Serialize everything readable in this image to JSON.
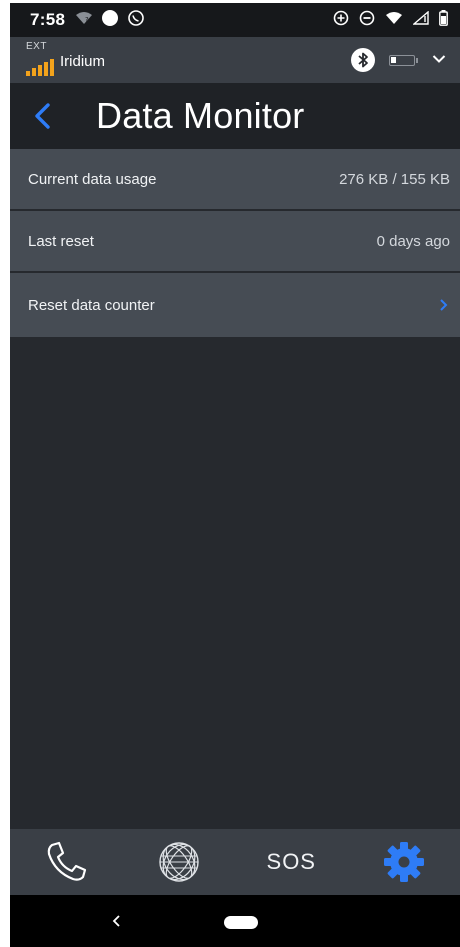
{
  "status_bar": {
    "time": "7:58"
  },
  "carrier": {
    "ext_label": "EXT",
    "name": "Iridium",
    "signal_color": "#f3a31c"
  },
  "header": {
    "title": "Data Monitor",
    "accent_color": "#2e7cf6"
  },
  "settings": {
    "rows": [
      {
        "label": "Current data usage",
        "value": "276 KB / 155 KB"
      },
      {
        "label": "Last reset",
        "value": "0 days ago"
      },
      {
        "label": "Reset data counter"
      }
    ]
  },
  "bottom_nav": {
    "items": [
      {
        "icon": "phone-icon"
      },
      {
        "icon": "globe-icon"
      },
      {
        "label": "SOS"
      },
      {
        "icon": "gear-icon",
        "active": true
      }
    ]
  }
}
